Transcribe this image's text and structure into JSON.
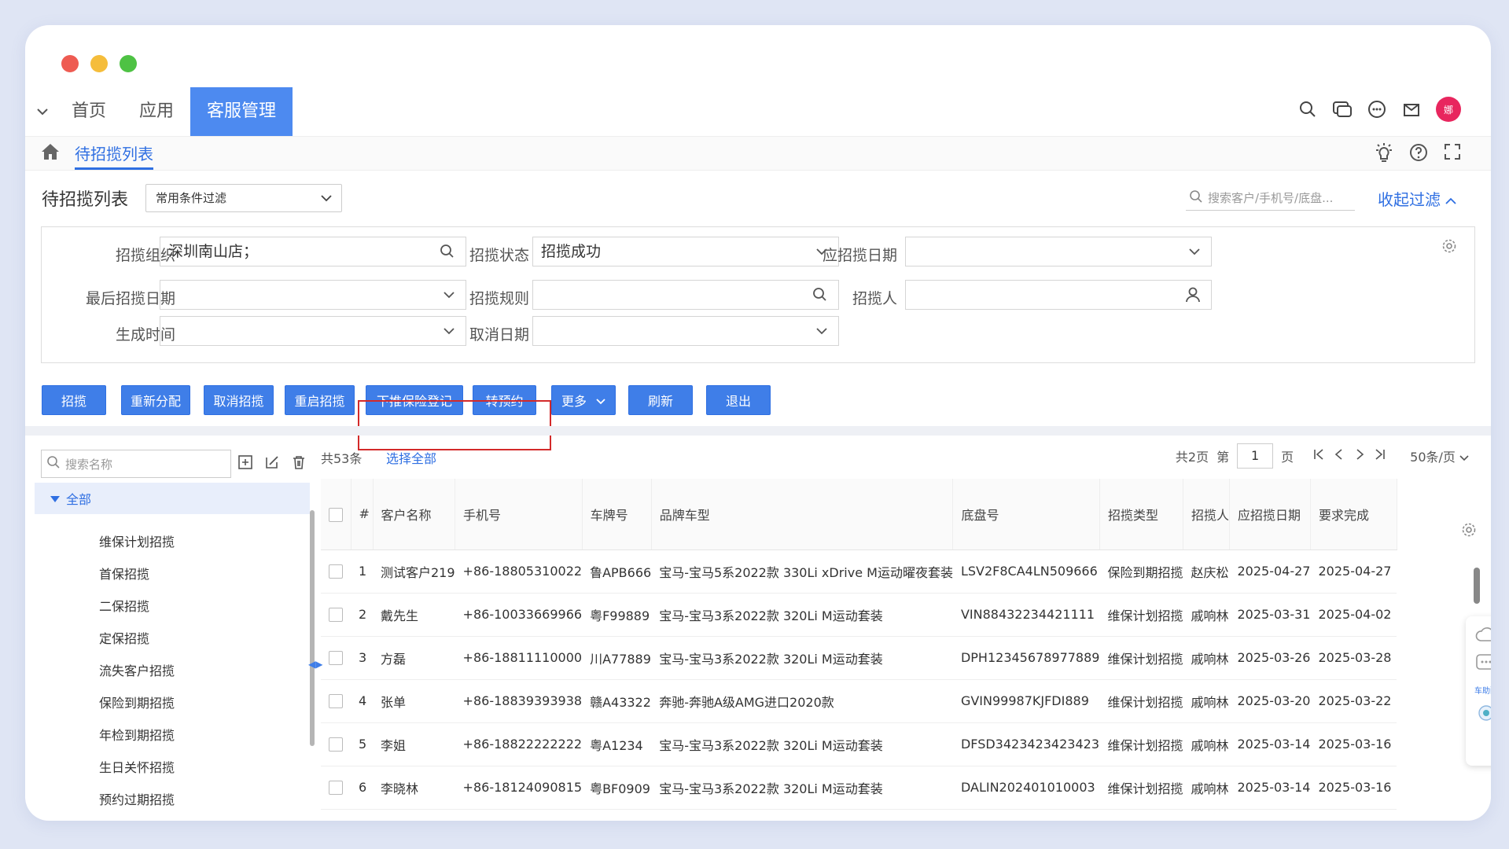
{
  "nav": {
    "items": [
      "首页",
      "应用",
      "客服管理"
    ]
  },
  "tab": {
    "label": "待招揽列表"
  },
  "title": "待招揽列表",
  "filter_dropdown": "常用条件过滤",
  "search_placeholder": "搜索客户/手机号/底盘...",
  "collapse_label": "收起过滤",
  "filters": [
    {
      "label": "招揽组织",
      "value": "深圳南山店；"
    },
    {
      "label": "招揽状态",
      "value": "招揽成功"
    },
    {
      "label": "应招揽日期",
      "value": ""
    },
    {
      "label": "最后招揽日期",
      "value": ""
    },
    {
      "label": "招揽规则",
      "value": ""
    },
    {
      "label": "招揽人",
      "value": ""
    },
    {
      "label": "生成时间",
      "value": ""
    },
    {
      "label": "取消日期",
      "value": ""
    }
  ],
  "toolbar": [
    "招揽",
    "重新分配",
    "取消招揽",
    "重启招揽",
    "下推保险登记",
    "转预约",
    "更多",
    "刷新",
    "退出"
  ],
  "tree": {
    "search_placeholder": "搜索名称",
    "all": "全部",
    "items": [
      "维保计划招揽",
      "首保招揽",
      "二保招揽",
      "定保招揽",
      "流失客户招揽",
      "保险到期招揽",
      "年检到期招揽",
      "生日关怀招揽",
      "预约过期招揽"
    ]
  },
  "summary": "共53条",
  "select_all": "选择全部",
  "pager": {
    "total_pages": "共2页",
    "page_prefix": "第",
    "page": "1",
    "page_suffix": "页",
    "page_size": "50条/页"
  },
  "columns": [
    "#",
    "客户名称",
    "手机号",
    "车牌号",
    "品牌车型",
    "底盘号",
    "招揽类型",
    "招揽人",
    "应招揽日期",
    "要求完成"
  ],
  "rows": [
    [
      "1",
      "测试客户219",
      "+86-18805310022",
      "鲁APB666",
      "宝马-宝马5系2022款 330Li xDrive M运动曜夜套装",
      "LSV2F8CA4LN509666",
      "保险到期招揽",
      "赵庆松",
      "2025-04-27",
      "2025-04-27"
    ],
    [
      "2",
      "戴先生",
      "+86-10033669966",
      "粤F99889",
      "宝马-宝马3系2022款 320Li M运动套装",
      "VIN88432234421111",
      "维保计划招揽",
      "戚响林",
      "2025-03-31",
      "2025-04-02"
    ],
    [
      "3",
      "方磊",
      "+86-18811110000",
      "川A77889",
      "宝马-宝马3系2022款 320Li M运动套装",
      "DPH12345678977889",
      "维保计划招揽",
      "戚响林",
      "2025-03-26",
      "2025-03-28"
    ],
    [
      "4",
      "张单",
      "+86-18839393938",
      "赣A43322",
      "奔驰-奔驰A级AMG进口2020款",
      "GVIN99987KJFDI889",
      "维保计划招揽",
      "戚响林",
      "2025-03-20",
      "2025-03-22"
    ],
    [
      "5",
      "李姐",
      "+86-18822222222",
      "粤A1234",
      "宝马-宝马3系2022款 320Li M运动套装",
      "DFSD3423423423423",
      "维保计划招揽",
      "戚响林",
      "2025-03-14",
      "2025-03-16"
    ],
    [
      "6",
      "李晓林",
      "+86-18124090815",
      "粤BF0909",
      "宝马-宝马3系2022款 320Li M运动套装",
      "DALIN202401010003",
      "维保计划招揽",
      "戚响林",
      "2025-03-14",
      "2025-03-16"
    ]
  ],
  "avatar_text": "娜",
  "float_label": "车助配",
  "colors": {
    "primary": "#3f7ee8",
    "nav_active": "#4d8af0",
    "highlight": "#d32a2a"
  }
}
